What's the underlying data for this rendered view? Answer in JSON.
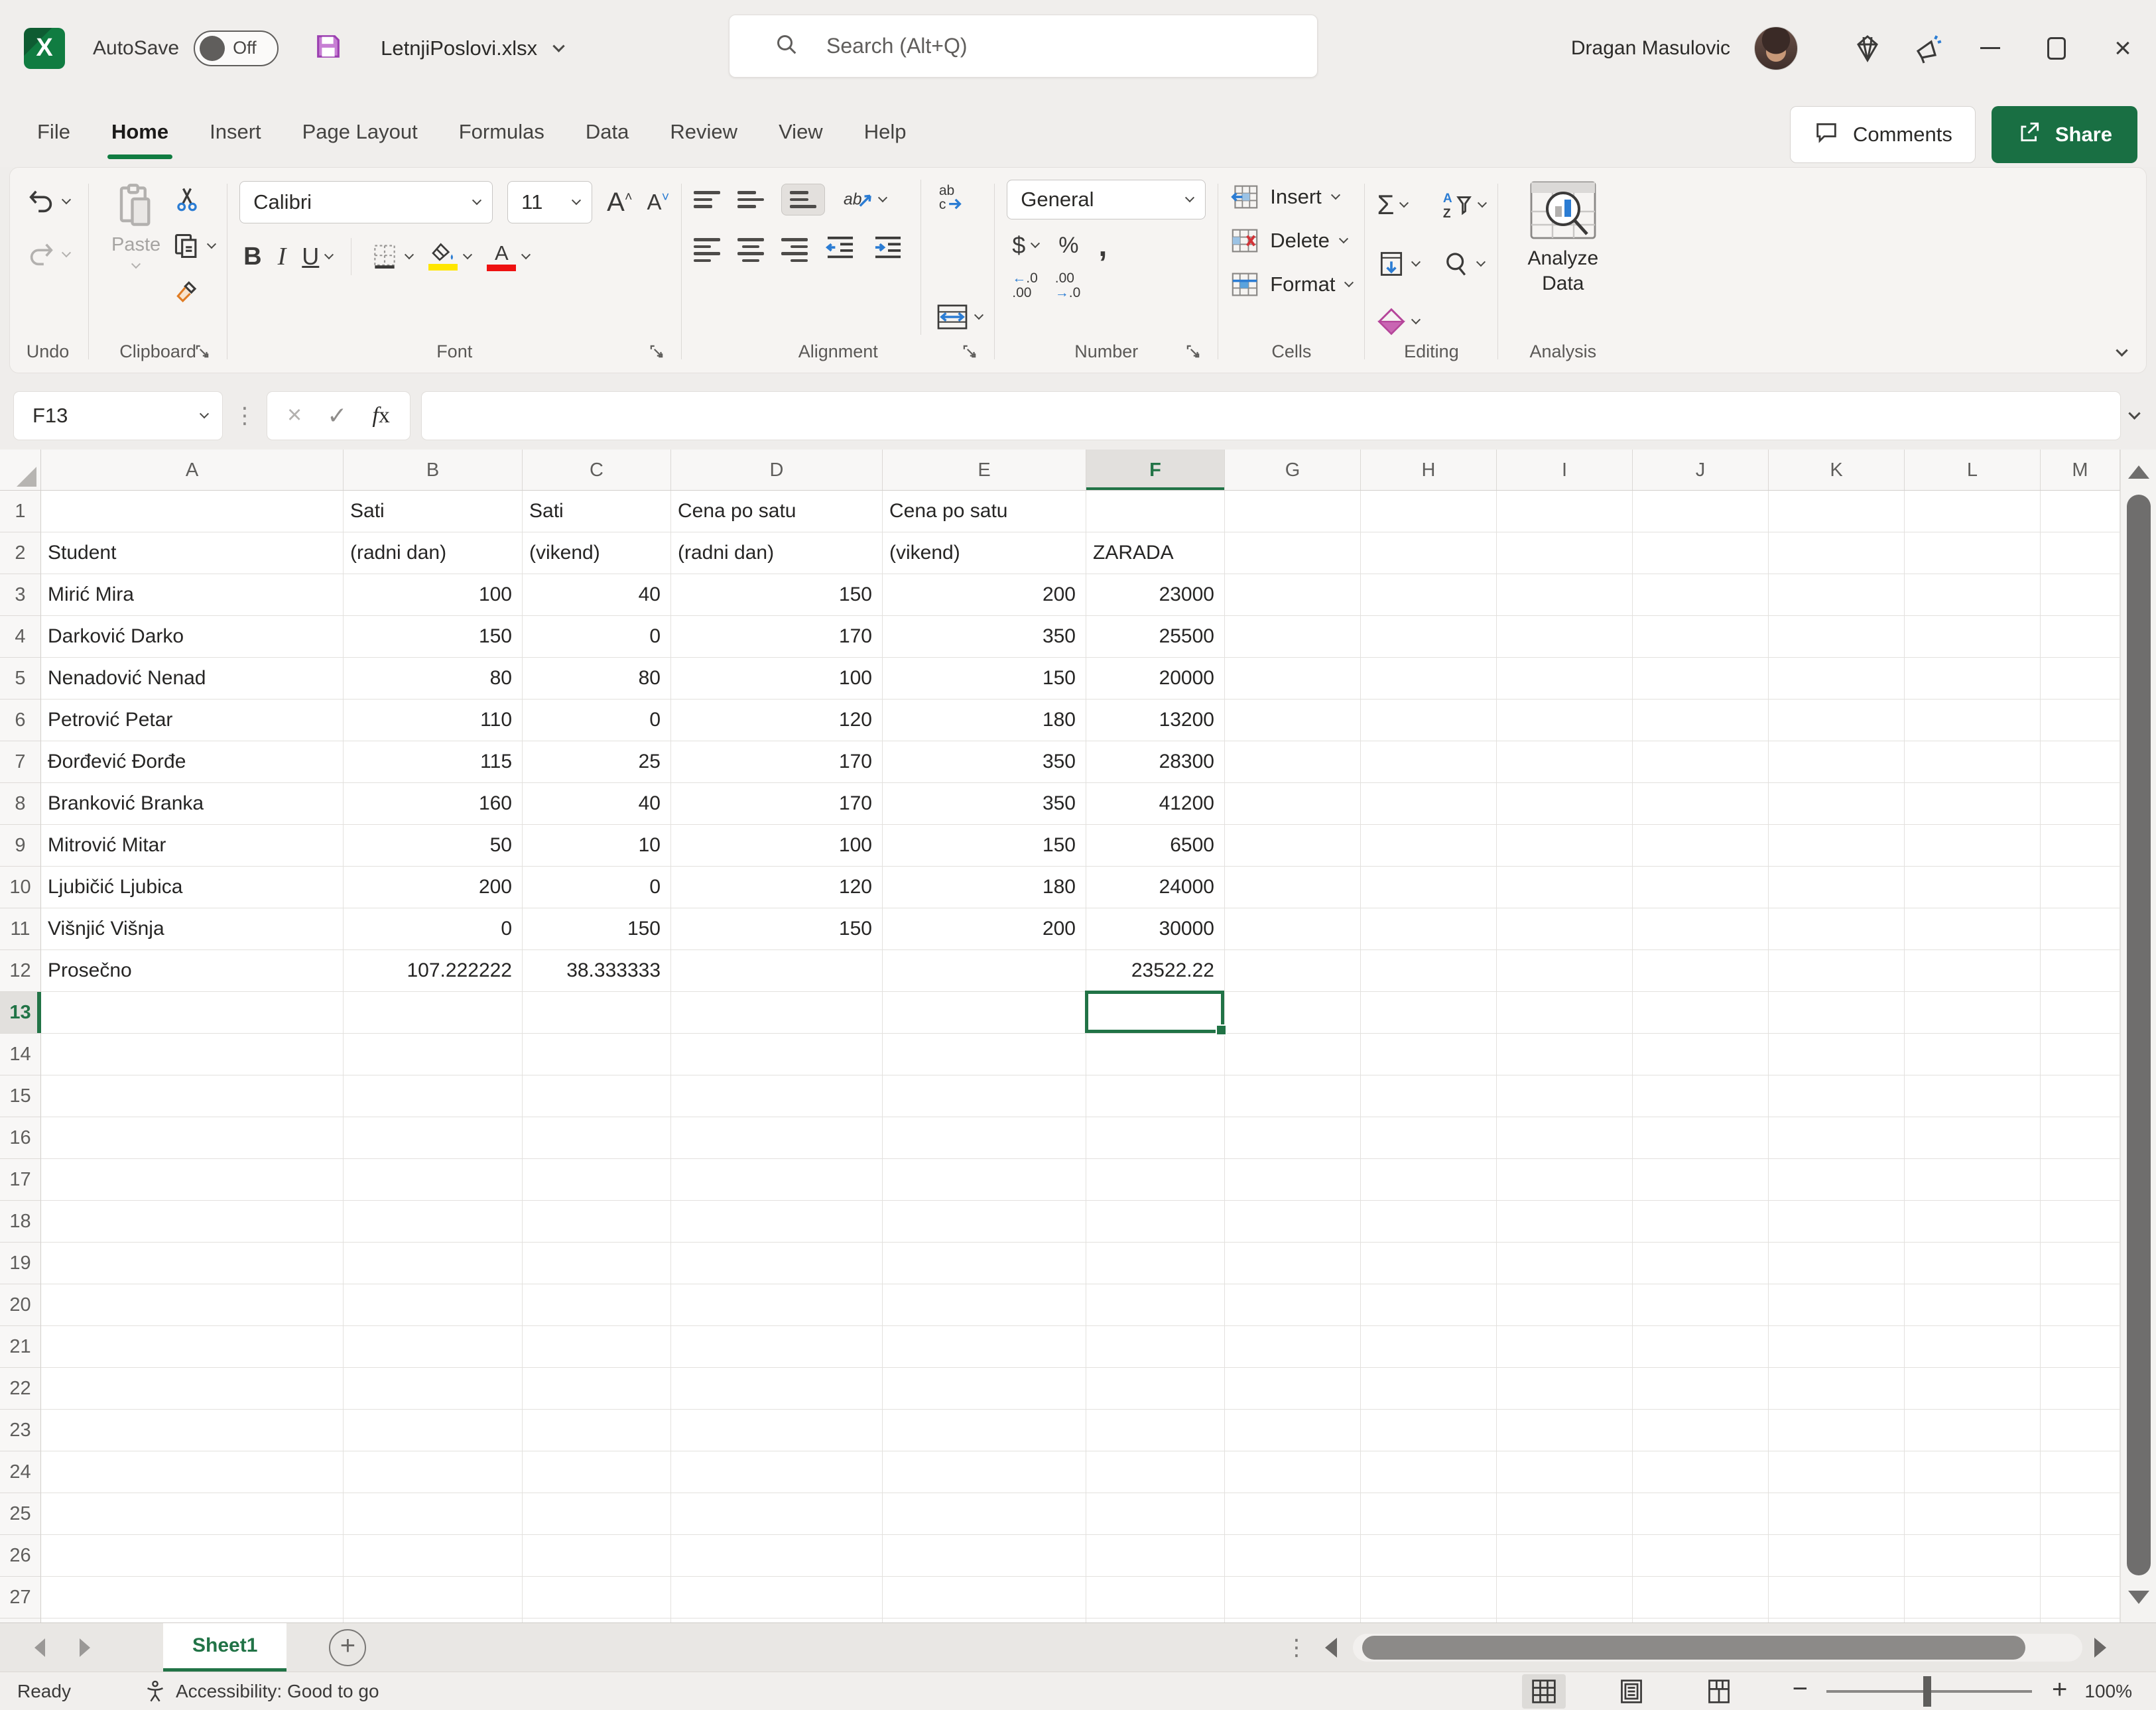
{
  "titlebar": {
    "autosave_label": "AutoSave",
    "autosave_state": "Off",
    "filename": "LetnjiPoslovi.xlsx",
    "user_name": "Dragan Masulovic",
    "search_placeholder": "Search (Alt+Q)"
  },
  "ribbon_tabs": [
    {
      "label": "File",
      "active": false
    },
    {
      "label": "Home",
      "active": true
    },
    {
      "label": "Insert",
      "active": false
    },
    {
      "label": "Page Layout",
      "active": false
    },
    {
      "label": "Formulas",
      "active": false
    },
    {
      "label": "Data",
      "active": false
    },
    {
      "label": "Review",
      "active": false
    },
    {
      "label": "View",
      "active": false
    },
    {
      "label": "Help",
      "active": false
    }
  ],
  "top_actions": {
    "comments_label": "Comments",
    "share_label": "Share"
  },
  "ribbon": {
    "paste_label": "Paste",
    "font_name": "Calibri",
    "font_size": "11",
    "number_format": "General",
    "cells": {
      "insert_label": "Insert",
      "delete_label": "Delete",
      "format_label": "Format"
    },
    "analysis_line1": "Analyze",
    "analysis_line2": "Data",
    "group_labels": {
      "undo": "Undo",
      "clipboard": "Clipboard",
      "font": "Font",
      "alignment": "Alignment",
      "number": "Number",
      "cells": "Cells",
      "editing": "Editing",
      "analysis": "Analysis"
    }
  },
  "formula_bar": {
    "cell_reference": "F13",
    "formula_value": ""
  },
  "sheet": {
    "tab_name": "Sheet1",
    "active_cell": "F13",
    "active_column": "F",
    "active_row": 13,
    "columns": [
      "A",
      "B",
      "C",
      "D",
      "E",
      "F",
      "G",
      "H",
      "I",
      "J",
      "K",
      "L",
      "M"
    ],
    "visible_rows": 27,
    "header_row_1": {
      "B": "Sati",
      "C": "Sati",
      "D": "Cena po satu",
      "E": "Cena po satu"
    },
    "header_row_2": {
      "A": "Student",
      "B": "(radni dan)",
      "C": "(vikend)",
      "D": "(radni dan)",
      "E": "(vikend)",
      "F": "ZARADA"
    },
    "records": [
      {
        "row": 3,
        "name": "Mirić Mira",
        "values": {
          "B": "100",
          "C": "40",
          "D": "150",
          "E": "200",
          "F": "23000"
        }
      },
      {
        "row": 4,
        "name": "Darković Darko",
        "values": {
          "B": "150",
          "C": "0",
          "D": "170",
          "E": "350",
          "F": "25500"
        }
      },
      {
        "row": 5,
        "name": "Nenadović Nenad",
        "values": {
          "B": "80",
          "C": "80",
          "D": "100",
          "E": "150",
          "F": "20000"
        }
      },
      {
        "row": 6,
        "name": "Petrović Petar",
        "values": {
          "B": "110",
          "C": "0",
          "D": "120",
          "E": "180",
          "F": "13200"
        }
      },
      {
        "row": 7,
        "name": "Đorđević Đorđe",
        "values": {
          "B": "115",
          "C": "25",
          "D": "170",
          "E": "350",
          "F": "28300"
        }
      },
      {
        "row": 8,
        "name": "Branković Branka",
        "values": {
          "B": "160",
          "C": "40",
          "D": "170",
          "E": "350",
          "F": "41200"
        }
      },
      {
        "row": 9,
        "name": "Mitrović Mitar",
        "values": {
          "B": "50",
          "C": "10",
          "D": "100",
          "E": "150",
          "F": "6500"
        }
      },
      {
        "row": 10,
        "name": "Ljubičić Ljubica",
        "values": {
          "B": "200",
          "C": "0",
          "D": "120",
          "E": "180",
          "F": "24000"
        }
      },
      {
        "row": 11,
        "name": "Višnjić Višnja",
        "values": {
          "B": "0",
          "C": "150",
          "D": "150",
          "E": "200",
          "F": "30000"
        }
      },
      {
        "row": 12,
        "name": "Prosečno",
        "values": {
          "B": "107.222222",
          "C": "38.333333",
          "F": "23522.22"
        }
      }
    ]
  },
  "status_bar": {
    "mode": "Ready",
    "accessibility": "Accessibility: Good to go",
    "zoom_level": "100%"
  },
  "colors": {
    "excel_green": "#107c41",
    "selection_green": "#217346",
    "share_button_green": "#196f43",
    "highlight_yellow": "#ffe600",
    "font_color_red": "#ee1111",
    "accent_blue": "#2b7cd3"
  }
}
